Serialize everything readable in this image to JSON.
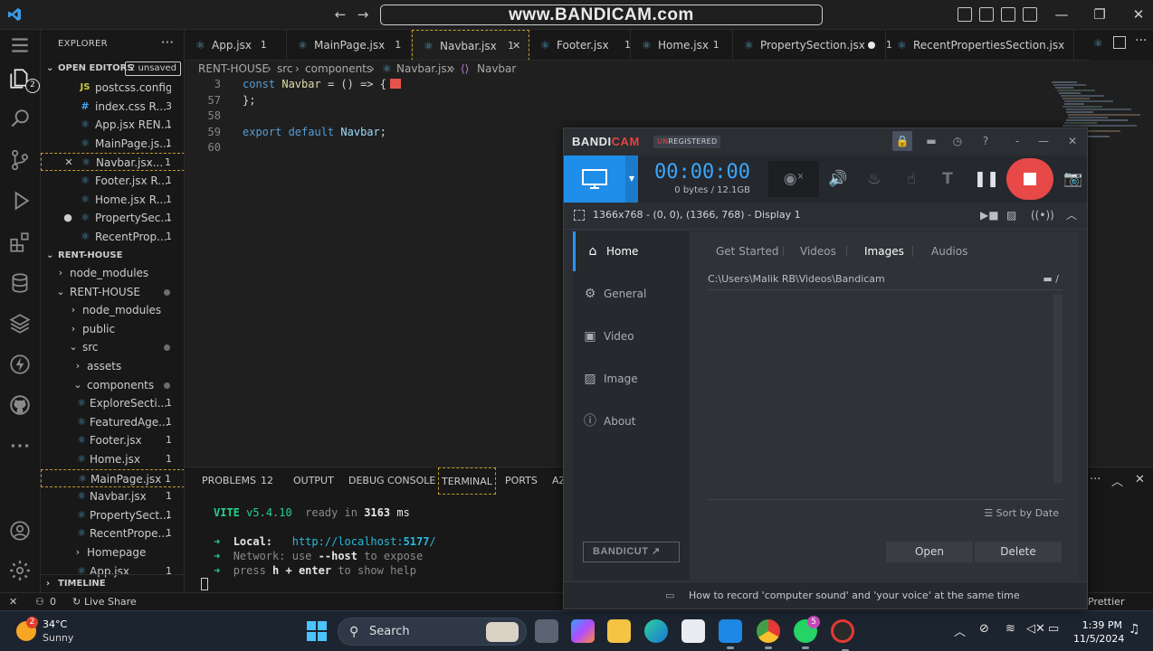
{
  "titlebar": {
    "watermark": "www.BANDICAM.com"
  },
  "sidebar": {
    "title": "EXPLORER",
    "more": "···",
    "open_editors_label": "OPEN EDITORS",
    "unsaved_badge": "2 unsaved",
    "open_editors": [
      {
        "name": "postcss.config.js...",
        "icon": "js-icon",
        "count": ""
      },
      {
        "name": "index.css  R...",
        "icon": "css-icon",
        "count": "3"
      },
      {
        "name": "App.jsx  REN...",
        "icon": "react-icon",
        "count": "1"
      },
      {
        "name": "MainPage.js...",
        "icon": "react-icon",
        "count": "1"
      },
      {
        "name": "Navbar.jsx...",
        "icon": "react-icon",
        "count": "1",
        "lead": "✕"
      },
      {
        "name": "Footer.jsx  R...",
        "icon": "react-icon",
        "count": "1"
      },
      {
        "name": "Home.jsx  R...",
        "icon": "react-icon",
        "count": "1"
      },
      {
        "name": "PropertySec...",
        "icon": "react-icon",
        "count": "1",
        "lead": "●"
      },
      {
        "name": "RecentProp...",
        "icon": "react-icon",
        "count": "1"
      }
    ],
    "project_label": "RENT-HOUSE",
    "tree": [
      {
        "name": "node_modules",
        "chevron": "›"
      },
      {
        "name": "RENT-HOUSE",
        "chevron": "⌄"
      },
      {
        "name": "node_modules",
        "chevron": "›"
      },
      {
        "name": "public",
        "chevron": "›"
      },
      {
        "name": "src",
        "chevron": "⌄"
      },
      {
        "name": "assets",
        "chevron": "›"
      },
      {
        "name": "components",
        "chevron": "⌄"
      },
      {
        "name": "ExploreSecti...",
        "count": "1"
      },
      {
        "name": "FeaturedAge...",
        "count": "1"
      },
      {
        "name": "Footer.jsx",
        "count": "1"
      },
      {
        "name": "Home.jsx",
        "count": "1"
      },
      {
        "name": "MainPage.jsx",
        "count": "1"
      },
      {
        "name": "Navbar.jsx",
        "count": "1"
      },
      {
        "name": "PropertySect...",
        "count": "1"
      },
      {
        "name": "RecentPrope...",
        "count": "1"
      },
      {
        "name": "Homepage",
        "chevron": "›"
      },
      {
        "name": "App.jsx",
        "count": "1"
      }
    ],
    "timeline_label": "TIMELINE"
  },
  "tabs": [
    {
      "name": "App.jsx",
      "count": "1"
    },
    {
      "name": "MainPage.jsx",
      "count": "1"
    },
    {
      "name": "Navbar.jsx",
      "count": "1"
    },
    {
      "name": "Footer.jsx",
      "count": "1"
    },
    {
      "name": "Home.jsx",
      "count": "1"
    },
    {
      "name": "PropertySection.jsx",
      "count": "1"
    },
    {
      "name": "RecentPropertiesSection.jsx",
      "count": "1"
    }
  ],
  "breadcrumb": [
    "RENT-HOUSE",
    "src",
    "components",
    "Navbar.jsx",
    "Navbar"
  ],
  "editor": {
    "lines": [
      {
        "num": "3",
        "kw": "const",
        "name": "Navbar",
        "rest": " = () => {"
      },
      {
        "num": "57",
        "text": "};"
      },
      {
        "num": "58",
        "text": ""
      },
      {
        "num": "59",
        "kw": "export default",
        "name": "Navbar",
        "rest": ";"
      },
      {
        "num": "60",
        "text": ""
      }
    ]
  },
  "panel": {
    "tabs": [
      "PROBLEMS",
      "12",
      "OUTPUT",
      "DEBUG CONSOLE",
      "TERMINAL",
      "PORTS",
      "AZ"
    ],
    "terminal": {
      "vite": "VITE",
      "version": "v5.4.10",
      "ready": "ready in",
      "ms_value": "3163",
      "ms": "ms",
      "arrow": "➜",
      "local_label": "Local:",
      "local_url_a": "http://localhost:",
      "local_port": "5177",
      "local_url_b": "/",
      "network_label": "Network:",
      "network_a": "use",
      "network_flag": "--host",
      "network_b": "to expose",
      "help_a": "press",
      "help_key": "h + enter",
      "help_b": "to show help"
    }
  },
  "statusbar": {
    "errors": "0",
    "live_share": "Live Share",
    "prettier": "Prettier"
  },
  "taskbar": {
    "weather_badge": "2",
    "temp": "34°C",
    "condition": "Sunny",
    "search": "Search",
    "whatsapp_badge": "5",
    "time": "1:39 PM",
    "date": "11/5/2024"
  },
  "bandicam": {
    "logo_a": "BANDI",
    "logo_b": "CAM",
    "unreg_a": "UN",
    "unreg_b": "REGISTERED",
    "timer": "00:00:00",
    "size": "0 bytes / 12.1GB",
    "display_info": "1366x768 - (0, 0), (1366, 768) - Display 1",
    "nav": [
      {
        "label": "Home",
        "icon": "home-icon"
      },
      {
        "label": "General",
        "icon": "gear-icon"
      },
      {
        "label": "Video",
        "icon": "video-icon"
      },
      {
        "label": "Image",
        "icon": "image-icon"
      },
      {
        "label": "About",
        "icon": "info-icon"
      }
    ],
    "bandicut": "BANDICUT ↗",
    "subtabs": [
      "Get Started",
      "Videos",
      "Images",
      "Audios"
    ],
    "path": "C:\\Users\\Malik RB\\Videos\\Bandicam",
    "sort": "Sort by Date",
    "open": "Open",
    "delete": "Delete",
    "footer": "How to record 'computer sound' and 'your voice' at the same time"
  }
}
